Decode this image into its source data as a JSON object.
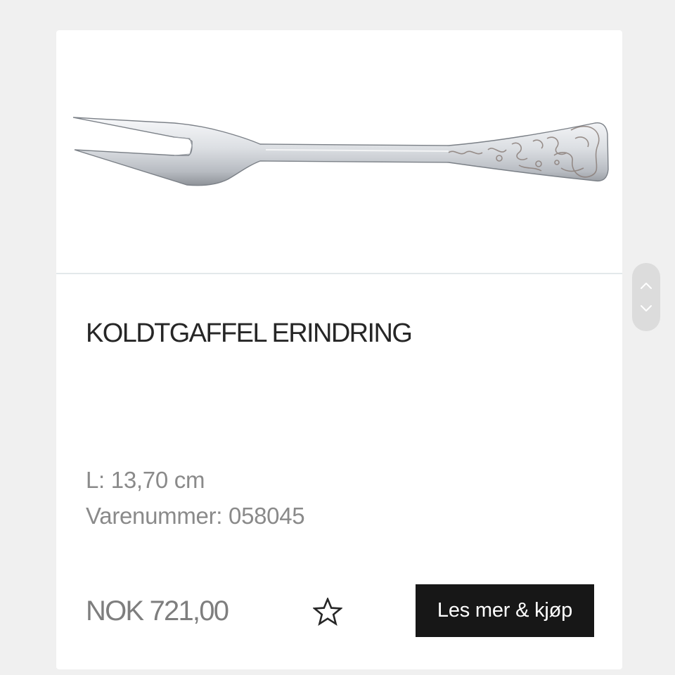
{
  "product": {
    "name": "KOLDTGAFFEL ERINDRING",
    "length": "L: 13,70 cm",
    "sku": "Varenummer: 058045",
    "price": "NOK 721,00",
    "image": "cold-meat-fork-photo"
  },
  "actions": {
    "favorite_icon": "star-outline-icon",
    "buy_label": "Les mer & kjøp"
  },
  "scroll": {
    "up_icon": "chevron-up-icon",
    "down_icon": "chevron-down-icon"
  },
  "colors": {
    "page_background": "#f0f0f0",
    "card_background": "#ffffff",
    "title_text": "#262626",
    "muted_text": "#8a8a8a",
    "button_background": "#171717",
    "button_text": "#ffffff"
  }
}
